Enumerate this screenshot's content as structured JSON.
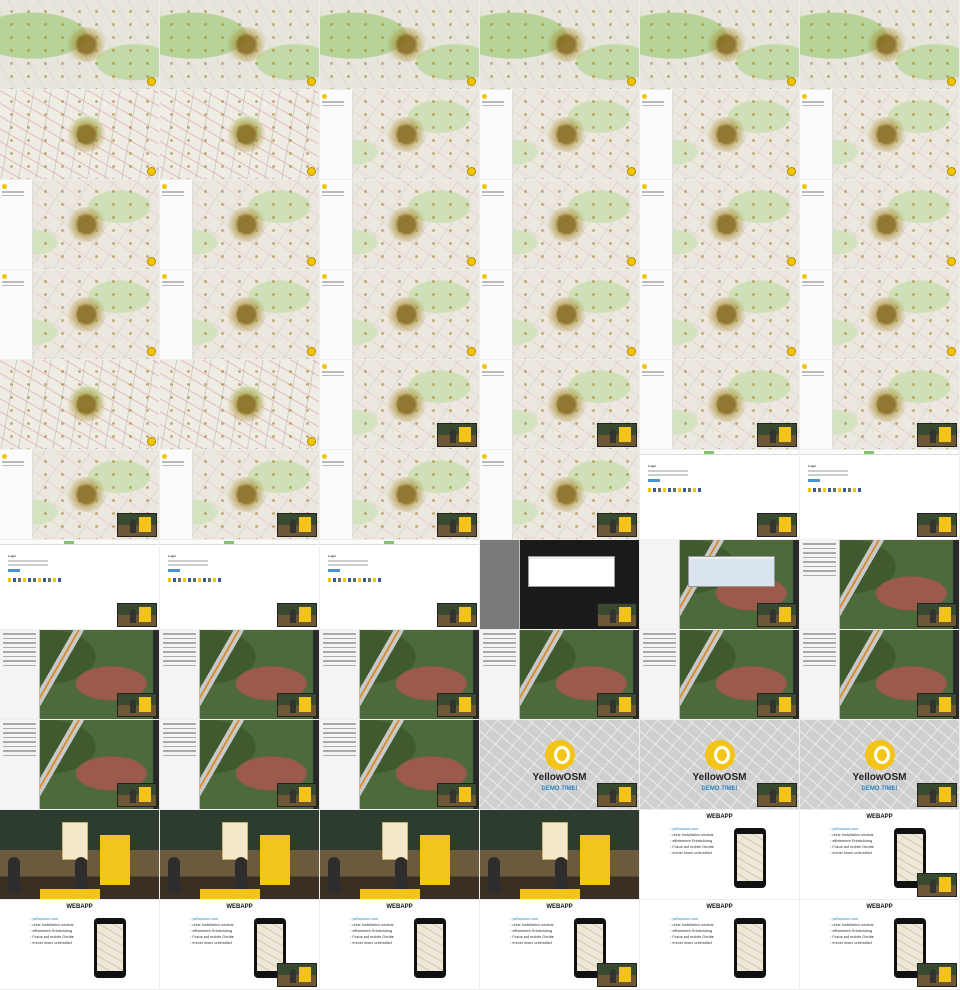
{
  "sheet": {
    "columns": 6,
    "rows": 11,
    "accent_color": "#f5c400",
    "link_color": "#2a86c5"
  },
  "slide_yellowosm": {
    "brand": "YellowOSM",
    "demo": "DEMO TIME!"
  },
  "slide_webapp": {
    "title": "WEBAPP",
    "bullets": [
      "yellowosm.com",
      "ohne Installation nutzbar",
      "effizientere Entwicklung",
      "Fokus auf mobile Geräte",
      "Immer lesen unterstützt"
    ]
  },
  "login": {
    "title": "Login"
  },
  "cells": [
    "map-green",
    "map-green",
    "map-green",
    "map-green",
    "map-green",
    "map-green",
    "map-roads",
    "map-roads",
    "map-panel",
    "map-panel",
    "map-panel",
    "map-panel",
    "map-panel",
    "map-panel",
    "map-panel",
    "map-panel",
    "map-panel",
    "map-panel",
    "map-panel",
    "map-panel",
    "map-panel",
    "map-panel",
    "map-panel",
    "map-panel",
    "map-roads",
    "map-roads",
    "map-panel-pip",
    "map-panel-pip",
    "map-panel-pip",
    "map-panel-pip",
    "map-panel-pip",
    "map-panel-pip",
    "map-panel-pip",
    "map-panel-pip",
    "login-pip",
    "login-pip",
    "login-pip",
    "login-pip",
    "login-pip",
    "modal-dark",
    "modal-satellite",
    "satellite-side",
    "satellite-side",
    "satellite-side",
    "satellite-side",
    "satellite-side",
    "satellite-side",
    "satellite-side",
    "satellite-side",
    "satellite-side",
    "satellite-side",
    "yellowosm",
    "yellowosm",
    "yellowosm",
    "stage",
    "stage",
    "stage",
    "stage",
    "webapp",
    "webapp",
    "webapp",
    "webapp",
    "webapp",
    "webapp",
    "webapp",
    "webapp"
  ]
}
